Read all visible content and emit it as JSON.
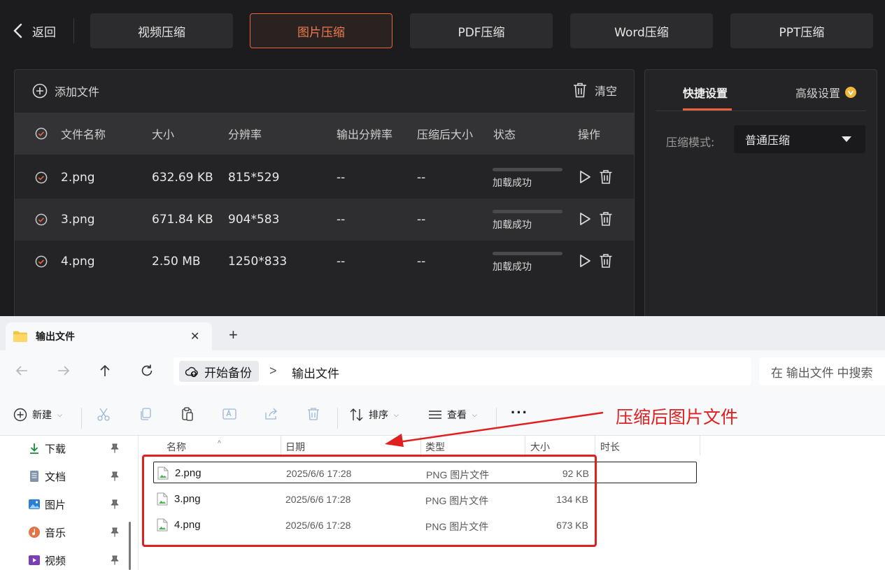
{
  "app": {
    "back_label": "返回",
    "tabs": [
      {
        "label": "视频压缩",
        "active": false
      },
      {
        "label": "图片压缩",
        "active": true
      },
      {
        "label": "PDF压缩",
        "active": false
      },
      {
        "label": "Word压缩",
        "active": false
      },
      {
        "label": "PPT压缩",
        "active": false
      }
    ],
    "add_file_label": "添加文件",
    "clear_label": "清空",
    "table": {
      "headers": [
        "文件名称",
        "大小",
        "分辨率",
        "输出分辨率",
        "压缩后大小",
        "状态",
        "操作"
      ],
      "rows": [
        {
          "name": "2.png",
          "size": "632.69 KB",
          "resolution": "815*529",
          "output_resolution": "--",
          "compressed_size": "--",
          "status": "加载成功",
          "checked": true
        },
        {
          "name": "3.png",
          "size": "671.84 KB",
          "resolution": "904*583",
          "output_resolution": "--",
          "compressed_size": "--",
          "status": "加载成功",
          "checked": true
        },
        {
          "name": "4.png",
          "size": "2.50 MB",
          "resolution": "1250*833",
          "output_resolution": "--",
          "compressed_size": "--",
          "status": "加载成功",
          "checked": true
        }
      ]
    },
    "settings": {
      "quick_tab": "快捷设置",
      "advanced_tab": "高级设置",
      "mode_label": "压缩模式:",
      "mode_value": "普通压缩"
    },
    "colors": {
      "accent": "#e8643c",
      "bg": "#1c1c1e",
      "panel": "#242426"
    }
  },
  "explorer": {
    "tab_title": "输出文件",
    "new_tab_symbol": "+",
    "close_symbol": "✕",
    "breadcrumb_root": "开始备份",
    "breadcrumb_sep": ">",
    "breadcrumb_current": "输出文件",
    "search_placeholder": "在 输出文件 中搜索",
    "toolbar": {
      "new_label": "新建",
      "sort_label": "排序",
      "view_label": "查看",
      "more_label": "···"
    },
    "sidebar": [
      {
        "label": "下载",
        "icon": "download-icon"
      },
      {
        "label": "文档",
        "icon": "document-icon"
      },
      {
        "label": "图片",
        "icon": "pictures-icon"
      },
      {
        "label": "音乐",
        "icon": "music-icon"
      },
      {
        "label": "视频",
        "icon": "video-icon"
      }
    ],
    "columns": [
      "名称",
      "日期",
      "类型",
      "大小",
      "时长"
    ],
    "files": [
      {
        "name": "2.png",
        "date": "2025/6/6 17:28",
        "type": "PNG 图片文件",
        "size": "92 KB"
      },
      {
        "name": "3.png",
        "date": "2025/6/6 17:28",
        "type": "PNG 图片文件",
        "size": "134 KB"
      },
      {
        "name": "4.png",
        "date": "2025/6/6 17:28",
        "type": "PNG 图片文件",
        "size": "673 KB"
      }
    ]
  },
  "annotation": {
    "text": "压缩后图片文件",
    "color": "#e02020"
  }
}
